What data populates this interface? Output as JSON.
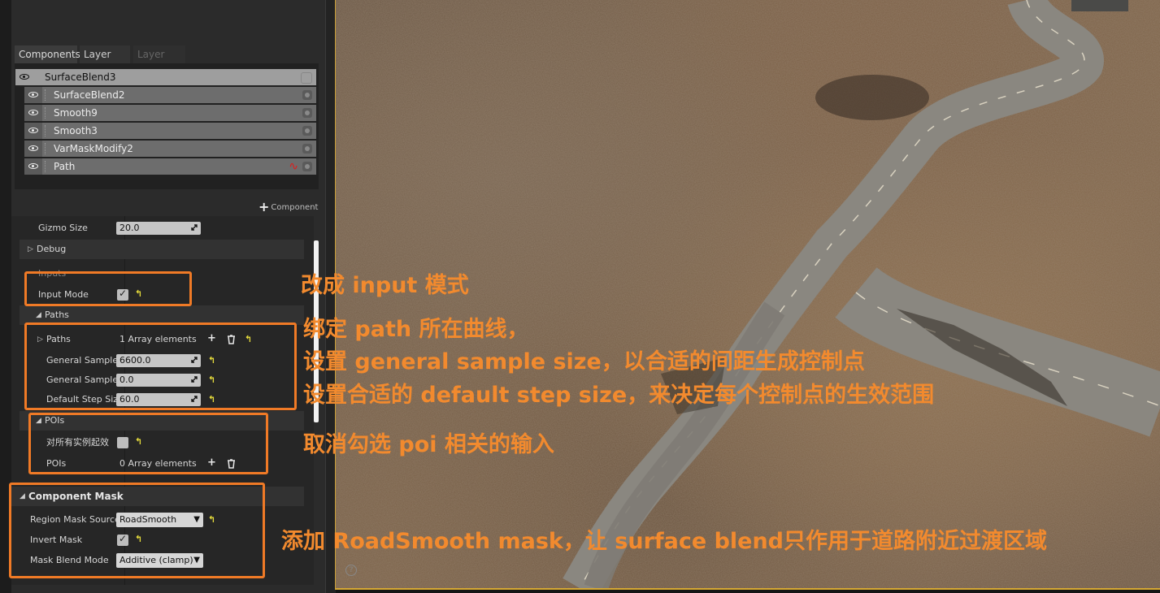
{
  "tabs": [
    {
      "label": "Components"
    },
    {
      "label": "Layer Info"
    },
    {
      "label": "Layer Edit"
    }
  ],
  "components": [
    {
      "label": "SurfaceBlend3"
    },
    {
      "label": "SurfaceBlend2"
    },
    {
      "label": "Smooth9"
    },
    {
      "label": "Smooth3"
    },
    {
      "label": "VarMaskModify2"
    },
    {
      "label": "Path"
    }
  ],
  "add_component": {
    "label": "Component"
  },
  "details": {
    "gizmo_size": {
      "label": "Gizmo Size",
      "value": "20.0"
    },
    "debug": {
      "label": "Debug"
    },
    "input_header": {
      "label": "Inputs"
    },
    "input_mode": {
      "label": "Input Mode",
      "checked": true
    },
    "paths_section": {
      "label": "Paths"
    },
    "paths": {
      "label": "Paths",
      "value": "1 Array elements"
    },
    "general_sample_1": {
      "label": "General Sample",
      "value": "6600.0"
    },
    "general_sample_2": {
      "label": "General Sample",
      "value": "0.0"
    },
    "default_step": {
      "label": "Default Step Siz",
      "value": "60.0"
    },
    "pois_section": {
      "label": "POIs"
    },
    "apply_all": {
      "label": "对所有实例起效",
      "checked": false
    },
    "pois": {
      "label": "POIs",
      "value": "0 Array elements"
    },
    "component_mask": {
      "label": "Component Mask"
    },
    "region_mask_source": {
      "label": "Region Mask Source",
      "value": "RoadSmooth"
    },
    "invert_mask": {
      "label": "Invert Mask",
      "checked": true
    },
    "mask_blend_mode": {
      "label": "Mask Blend Mode",
      "value": "Additive (clamp)"
    }
  },
  "annotations": {
    "input_mode": "改成 input 模式",
    "path_line1": "绑定 path 所在曲线，",
    "path_line2": "设置 general sample size，以合适的间距生成控制点",
    "path_line3": "设置合适的 default step size，来决定每个控制点的生效范围",
    "poi": "取消勾选 poi 相关的输入",
    "mask": "添加 RoadSmooth mask，让 surface blend只作用于道路附近过渡区域"
  },
  "colors": {
    "annotation": "#f28a2e",
    "highlight_border": "#f07a26",
    "reset_arrow": "#e7dd3c",
    "viewport_border": "#d7a933"
  }
}
